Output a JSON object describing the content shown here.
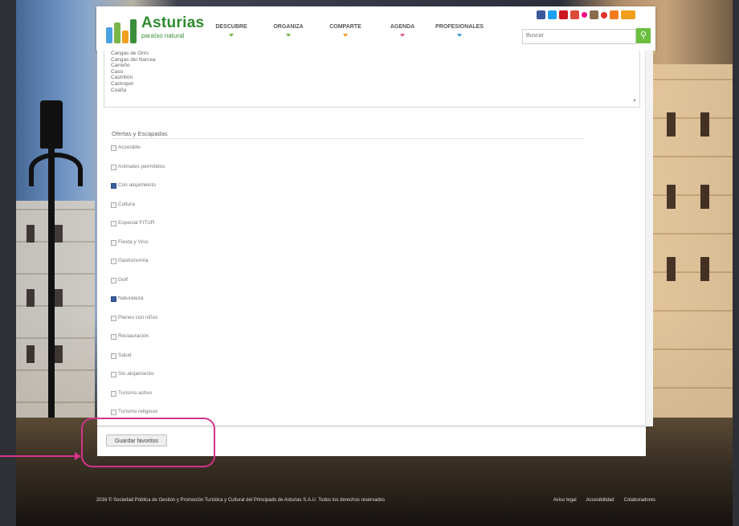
{
  "header": {
    "logo_title": "Asturias",
    "logo_subtitle": "paraíso natural",
    "nav": [
      "DESCUBRE",
      "ORGANIZA",
      "COMPARTE",
      "AGENDA",
      "PROFESIONALES"
    ],
    "search_placeholder": "Buscar",
    "search_icon": "magnifier-icon",
    "social_icons": [
      "facebook-icon",
      "twitter-icon",
      "youtube-icon",
      "googleplus-icon",
      "flickr-icon",
      "instagram-icon",
      "pinterest-icon",
      "foursquare-icon",
      "rss-icon"
    ]
  },
  "municipality_list": {
    "items": [
      "Cangas de Onís",
      "Cangas del Narcea",
      "Carreño",
      "Caso",
      "Castrillón",
      "Castropol",
      "Coaña"
    ]
  },
  "offers": {
    "title": "Ofertas y Escapadas",
    "options": [
      {
        "label": "Accesible",
        "checked": false
      },
      {
        "label": "Animales permitidos",
        "checked": false
      },
      {
        "label": "Con alojamiento",
        "checked": true
      },
      {
        "label": "Cultura",
        "checked": false
      },
      {
        "label": "Especial FITUR",
        "checked": false
      },
      {
        "label": "Fiesta y Vino",
        "checked": false
      },
      {
        "label": "Gastronomía",
        "checked": false
      },
      {
        "label": "Golf",
        "checked": false
      },
      {
        "label": "Naturaleza",
        "checked": true
      },
      {
        "label": "Planes con niños",
        "checked": false
      },
      {
        "label": "Restauración",
        "checked": false
      },
      {
        "label": "Salud",
        "checked": false
      },
      {
        "label": "Sin alojamiento",
        "checked": false
      },
      {
        "label": "Turismo activo",
        "checked": false
      },
      {
        "label": "Turismo religioso",
        "checked": false
      }
    ]
  },
  "actions": {
    "save_label": "Guardar favoritos"
  },
  "footer": {
    "copyright": "2016 © Sociedad Pública de Gestión y Promoción Turística y Cultural del Principado de Asturias S.A.U. Todos los derechos reservados",
    "links": [
      "Aviso legal",
      "Accesibilidad",
      "Colaboradores"
    ]
  },
  "colors": {
    "brand_green": "#2e8b2e",
    "search_button": "#6bbf3f",
    "annotation_magenta": "#d6338a",
    "header_gold": "#c9b27a"
  }
}
